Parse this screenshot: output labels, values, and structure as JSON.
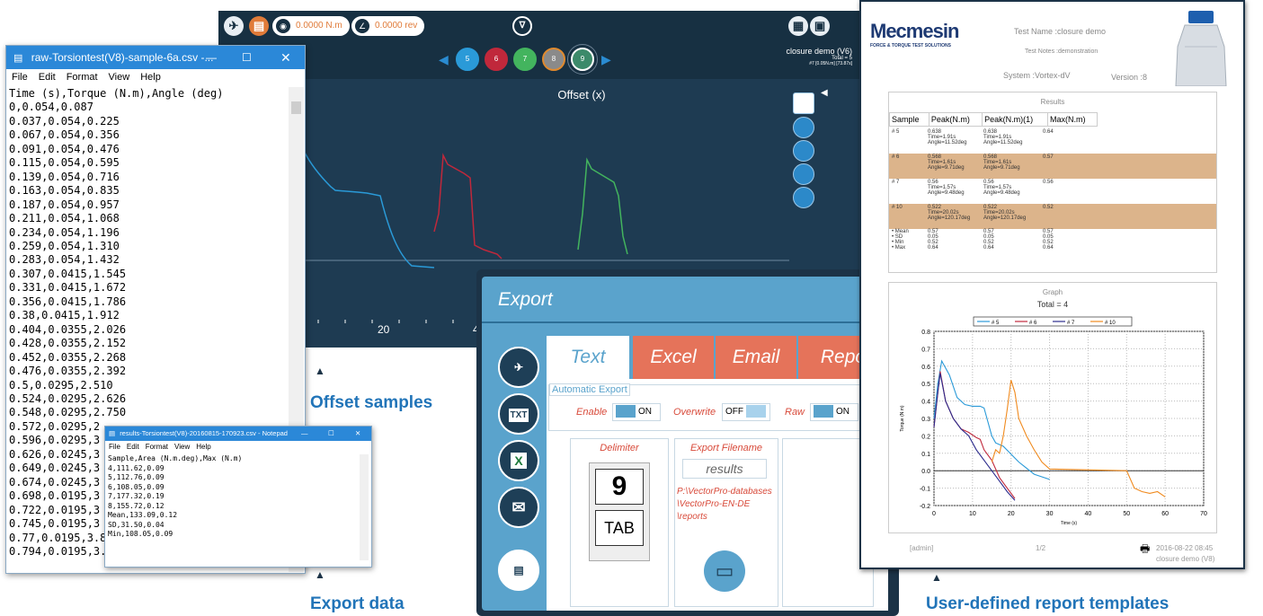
{
  "app": {
    "readout_torque": "0.0000 N.m",
    "readout_angle": "0.0000 rev",
    "samples": [
      "5",
      "6",
      "7",
      "8",
      "9"
    ],
    "test_name": "closure demo (V6)",
    "test_total": "Total = 5",
    "test_info": "#7 [0.05N.m] [73.87s]",
    "plot_title": "Offset (x)",
    "x_ticks": [
      "20",
      "4"
    ]
  },
  "notepad1": {
    "title": "raw-Torsiontest(V8)-sample-6a.csv -...",
    "menu": [
      "File",
      "Edit",
      "Format",
      "View",
      "Help"
    ],
    "lines": [
      "Time (s),Torque (N.m),Angle (deg)",
      "0,0.054,0.087",
      "0.037,0.054,0.225",
      "0.067,0.054,0.356",
      "0.091,0.054,0.476",
      "0.115,0.054,0.595",
      "0.139,0.054,0.716",
      "0.163,0.054,0.835",
      "0.187,0.054,0.957",
      "0.211,0.054,1.068",
      "0.234,0.054,1.196",
      "0.259,0.054,1.310",
      "0.283,0.054,1.432",
      "0.307,0.0415,1.545",
      "0.331,0.0415,1.672",
      "0.356,0.0415,1.786",
      "0.38,0.0415,1.912",
      "0.404,0.0355,2.026",
      "0.428,0.0355,2.152",
      "0.452,0.0355,2.268",
      "0.476,0.0355,2.392",
      "0.5,0.0295,2.510",
      "0.524,0.0295,2.626",
      "0.548,0.0295,2.750",
      "0.572,0.0295,2",
      "0.596,0.0295,3",
      "0.626,0.0245,3",
      "0.649,0.0245,3",
      "0.674,0.0245,3",
      "0.698,0.0195,3",
      "0.722,0.0195,3",
      "0.745,0.0195,3",
      "0.77,0.0195,3.8",
      "0.794,0.0195,3.985"
    ]
  },
  "notepad2": {
    "title": "results-Torsiontest(V8)-20160815-170923.csv - Notepad",
    "menu": [
      "File",
      "Edit",
      "Format",
      "View",
      "Help"
    ],
    "lines": [
      "Sample,Area (N.m.deg),Max (N.m)",
      "4,111.62,0.09",
      "5,112.76,0.09",
      "6,108.05,0.09",
      "7,177.32,0.19",
      "8,155.72,0.12",
      "Mean,133.09,0.12",
      "SD,31.50,0.04",
      "Min,108.05,0.09"
    ]
  },
  "export": {
    "title": "Export",
    "tabs": [
      "Text",
      "Excel",
      "Email",
      "Repo"
    ],
    "side_labels": [
      "TXT",
      "X"
    ],
    "auto_export": "Automatic Export",
    "enable": "Enable",
    "enable_state": "ON",
    "overwrite": "Overwrite",
    "overwrite_state": "OFF",
    "raw": "Raw",
    "raw_state": "ON",
    "delimiter": "Delimiter",
    "delimiter_comma": "9",
    "delimiter_tab": "TAB",
    "filename_label": "Export Filename",
    "filename_value": "results",
    "path": "P:\\VectorPro-databases \\VectorPro-EN-DE \\reports"
  },
  "report": {
    "logo": "Mecmesin",
    "logo_sub": "FORCE & TORQUE TEST SOLUTIONS",
    "test_name": "Test Name :closure demo",
    "test_notes": "Test Notes :demonstration",
    "system": "System :Vortex-dV",
    "version": "Version :8",
    "results_heading": "Results",
    "columns": [
      "Sample",
      "Peak(N.m)",
      "Peak(N.m)(1)",
      "Max(N.m)"
    ],
    "rows": [
      {
        "s": "# 5",
        "p": "0.638",
        "t": "Time=1.91s",
        "a": "Angle=11.52deg",
        "p1": "0.638",
        "t1": "Time=1.91s",
        "a1": "Angle=11.52deg",
        "m": "0.64"
      },
      {
        "s": "# 6",
        "p": "0.568",
        "t": "Time=1.61s",
        "a": "Angle=9.71deg",
        "p1": "0.568",
        "t1": "Time=1.61s",
        "a1": "Angle=9.71deg",
        "m": "0.57"
      },
      {
        "s": "# 7",
        "p": "0.56",
        "t": "Time=1.57s",
        "a": "Angle=9.48deg",
        "p1": "0.56",
        "t1": "Time=1.57s",
        "a1": "Angle=9.48deg",
        "m": "0.56"
      },
      {
        "s": "# 10",
        "p": "0.522",
        "t": "Time=20.02s",
        "a": "Angle=120.17deg",
        "p1": "0.522",
        "t1": "Time=20.02s",
        "a1": "Angle=120.17deg",
        "m": "0.52"
      }
    ],
    "stats": [
      {
        "k": "• Mean",
        "a": "0.57",
        "b": "0.57",
        "c": "0.57"
      },
      {
        "k": "• SD",
        "a": "0.05",
        "b": "0.05",
        "c": "0.05"
      },
      {
        "k": "• Min",
        "a": "0.52",
        "b": "0.52",
        "c": "0.52"
      },
      {
        "k": "• Max",
        "a": "0.64",
        "b": "0.64",
        "c": "0.64"
      }
    ],
    "graph_heading": "Graph",
    "graph_total": "Total = 4",
    "footer_user": "[admin]",
    "footer_page": "1/2",
    "footer_date": "2016-08-22 08:45",
    "footer_sub": "closure demo (V8)"
  },
  "chart_data": {
    "type": "line",
    "title": "Total = 4",
    "xlabel": "Time (s)",
    "ylabel": "Torque (N.m)",
    "xlim": [
      0,
      70
    ],
    "ylim": [
      -0.2,
      0.8
    ],
    "x_ticks": [
      0,
      10,
      20,
      30,
      40,
      50,
      60,
      70
    ],
    "y_ticks": [
      0.8,
      0.7,
      0.6,
      0.5,
      0.4,
      0.3,
      0.2,
      0.1,
      0.0,
      -0.1,
      -0.2
    ],
    "series": [
      {
        "name": "# 5",
        "color": "#2a9ad8",
        "x": [
          0,
          1,
          2,
          4,
          6,
          8,
          10,
          12,
          13,
          14,
          15,
          16,
          18,
          22,
          26,
          30
        ],
        "y": [
          0.3,
          0.5,
          0.63,
          0.55,
          0.42,
          0.38,
          0.37,
          0.37,
          0.36,
          0.28,
          0.2,
          0.16,
          0.14,
          0.05,
          -0.02,
          -0.05
        ]
      },
      {
        "name": "# 6",
        "color": "#c0283b",
        "x": [
          0,
          1,
          1.6,
          3,
          5,
          7,
          9,
          11,
          12,
          13,
          15,
          17,
          19,
          21
        ],
        "y": [
          0.25,
          0.45,
          0.57,
          0.4,
          0.3,
          0.24,
          0.22,
          0.19,
          0.18,
          0.12,
          0.06,
          -0.04,
          -0.1,
          -0.16
        ]
      },
      {
        "name": "# 7",
        "color": "#2b2a8c",
        "x": [
          0,
          1,
          1.6,
          3,
          5,
          7,
          9,
          11,
          13,
          15,
          17,
          19,
          21
        ],
        "y": [
          0.25,
          0.45,
          0.56,
          0.4,
          0.3,
          0.24,
          0.2,
          0.12,
          0.06,
          0.0,
          -0.06,
          -0.12,
          -0.17
        ]
      },
      {
        "name": "# 10",
        "color": "#f08a1e",
        "x": [
          15,
          16,
          17,
          18,
          19,
          20,
          21,
          22,
          24,
          26,
          28,
          30,
          50,
          52,
          54,
          56,
          58,
          60
        ],
        "y": [
          0.05,
          0.12,
          0.1,
          0.2,
          0.35,
          0.52,
          0.45,
          0.3,
          0.2,
          0.12,
          0.05,
          0.01,
          0.0,
          -0.1,
          -0.12,
          -0.13,
          -0.12,
          -0.15
        ]
      }
    ]
  },
  "captions": {
    "offset": "Offset samples",
    "export": "Export data",
    "report": "User-defined report templates"
  }
}
